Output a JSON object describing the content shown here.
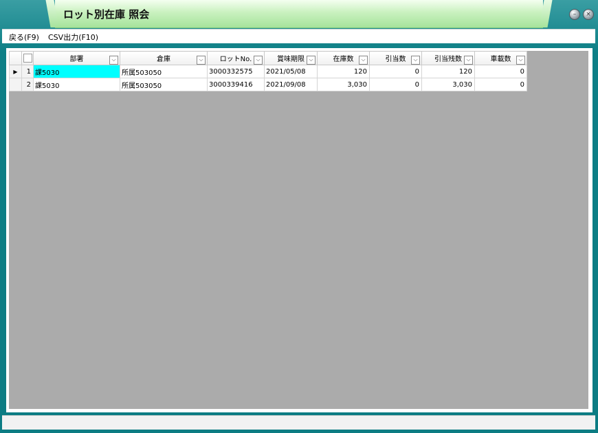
{
  "window": {
    "title": "ロット別在庫 照会"
  },
  "menu": {
    "back": "戻る(F9)",
    "csv": "CSV出力(F10)"
  },
  "grid": {
    "columns": [
      "部署",
      "倉庫",
      "ロットNo.",
      "賞味期限",
      "在庫数",
      "引当数",
      "引当残数",
      "車載数"
    ],
    "rows": [
      {
        "no": "1",
        "busho": "課5030",
        "souko": "所属503050",
        "lot": "3000332575",
        "kigen": "2021/05/08",
        "zaiko": "120",
        "hikiate": "0",
        "zan": "120",
        "shasai": "0"
      },
      {
        "no": "2",
        "busho": "課5030",
        "souko": "所属503050",
        "lot": "3000339416",
        "kigen": "2021/09/08",
        "zaiko": "3,030",
        "hikiate": "0",
        "zan": "3,030",
        "shasai": "0"
      }
    ]
  },
  "colors": {
    "frame": "#0c7c83",
    "title_tab": "#c9f1bf",
    "grid_bg": "#ababab",
    "current_cell": "#00ffff"
  },
  "icons": {
    "minimize": "minimize-icon",
    "close": "close-icon",
    "filter": "filter-dropdown-icon",
    "row_pointer": "row-pointer-icon"
  }
}
